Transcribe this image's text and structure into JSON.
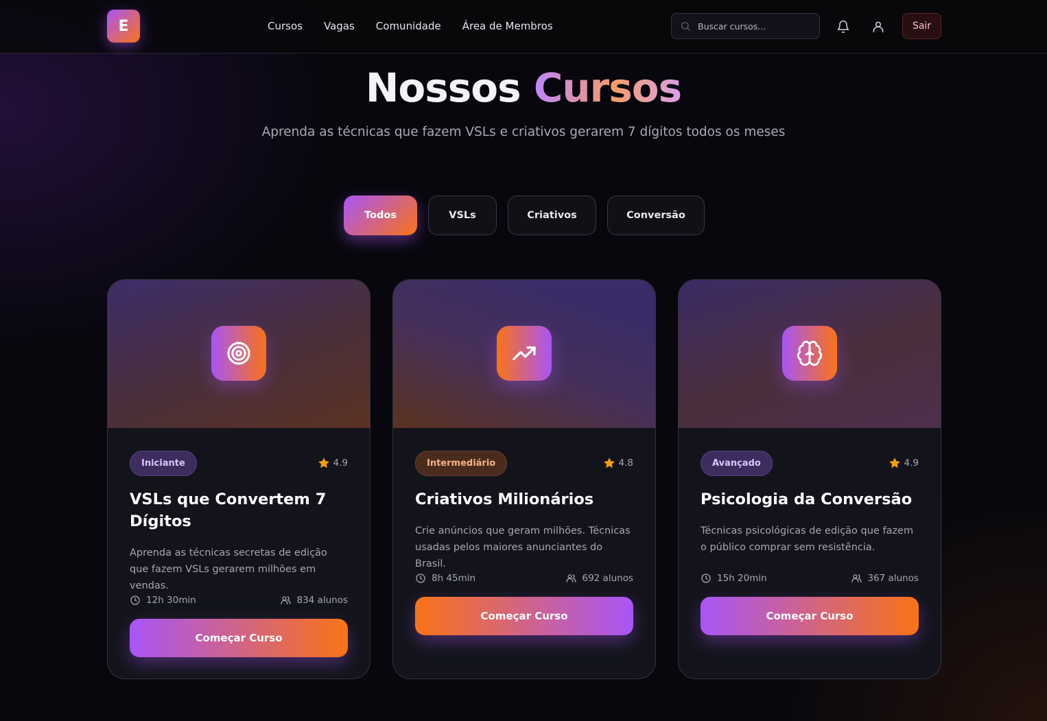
{
  "header": {
    "logo_letter": "E",
    "nav": [
      "Cursos",
      "Vagas",
      "Comunidade",
      "Área de Membros"
    ],
    "search_placeholder": "Buscar cursos...",
    "logout_label": "Sair"
  },
  "hero": {
    "title_part1": "Nossos",
    "title_part2": "Cursos",
    "subtitle": "Aprenda as técnicas que fazem VSLs e criativos gerarem 7 dígitos todos os meses"
  },
  "filters": [
    "Todos",
    "VSLs",
    "Criativos",
    "Conversão"
  ],
  "active_filter": "Todos",
  "courses": [
    {
      "icon": "target-icon",
      "level": "Iniciante",
      "rating": "4.9",
      "title": "VSLs que Convertem 7 Dígitos",
      "description": "Aprenda as técnicas secretas de edição que fazem VSLs gerarem milhões em vendas.",
      "duration": "12h 30min",
      "students": "834 alunos",
      "cta": "Começar Curso"
    },
    {
      "icon": "trending-up-icon",
      "level": "Intermediário",
      "rating": "4.8",
      "title": "Criativos Milionários",
      "description": "Crie anúncios que geram milhões. Técnicas usadas pelos maiores anunciantes do Brasil.",
      "duration": "8h 45min",
      "students": "692 alunos",
      "cta": "Começar Curso"
    },
    {
      "icon": "brain-icon",
      "level": "Avançado",
      "rating": "4.9",
      "title": "Psicologia da Conversão",
      "description": "Técnicas psicológicas de edição que fazem o público comprar sem resistência.",
      "duration": "15h 20min",
      "students": "367 alunos",
      "cta": "Começar Curso"
    }
  ],
  "colors": {
    "accent_purple": "#a855f7",
    "accent_orange": "#f97316",
    "star": "#f59e0b",
    "background": "#07070d"
  }
}
